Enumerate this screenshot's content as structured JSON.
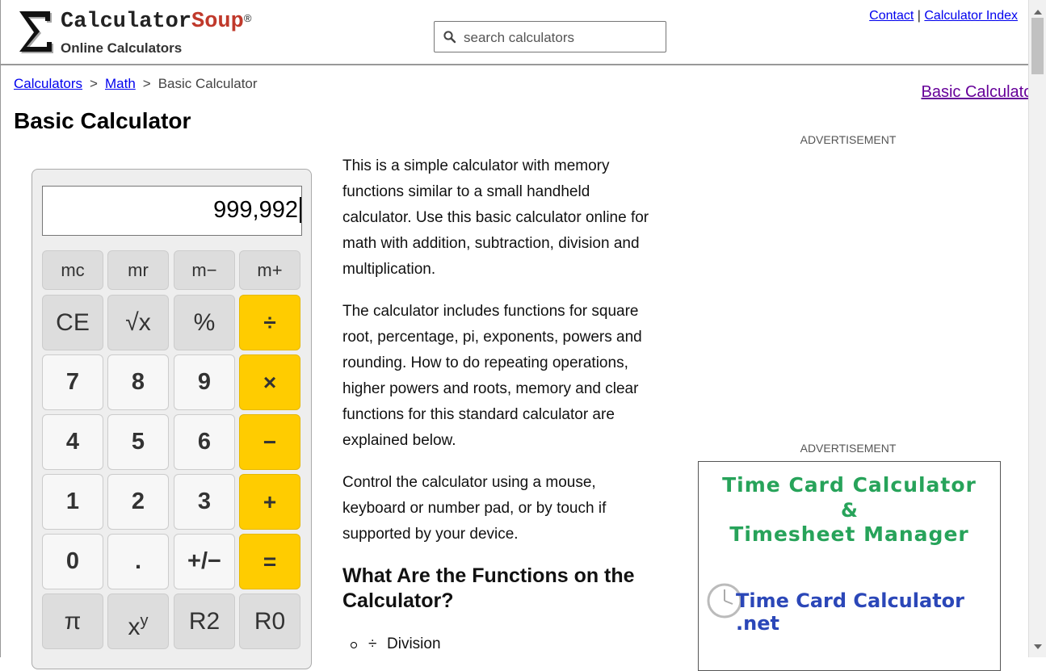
{
  "header": {
    "logo_name_a": "Calculator",
    "logo_name_b": "Soup",
    "logo_reg": "®",
    "logo_tagline": "Online Calculators",
    "search_placeholder": "search calculators",
    "links": {
      "contact": "Contact",
      "separator": "|",
      "index": "Calculator Index"
    }
  },
  "breadcrumb": {
    "items": [
      "Calculators",
      "Math"
    ],
    "current": "Basic Calculator",
    "separator": ">"
  },
  "right_link": "Basic Calculator",
  "page_title": "Basic Calculator",
  "calculator": {
    "display": "999,992",
    "memory_keys": [
      "mc",
      "mr",
      "m−",
      "m+"
    ],
    "rows": [
      [
        "CE",
        "√x",
        "%",
        "÷"
      ],
      [
        "7",
        "8",
        "9",
        "×"
      ],
      [
        "4",
        "5",
        "6",
        "−"
      ],
      [
        "1",
        "2",
        "3",
        "+"
      ],
      [
        "0",
        ".",
        "+/−",
        "="
      ]
    ],
    "bottom_keys": [
      "π",
      "x",
      "R2",
      "R0"
    ],
    "bottom_sup": "y"
  },
  "article": {
    "paragraphs": [
      "This is a simple calculator with memory functions similar to a small handheld calculator. Use this basic calculator online for math with addition, subtraction, division and multiplication.",
      "The calculator includes functions for square root, percentage, pi, exponents, powers and rounding. How to do repeating operations, higher powers and roots, memory and clear functions for this standard calculator are explained below.",
      "Control the calculator using a mouse, keyboard or number pad, or by touch if supported by your device."
    ],
    "heading": "What Are the Functions on the Calculator?",
    "list": [
      {
        "symbol": "÷",
        "label": "Division"
      }
    ]
  },
  "ads": {
    "label": "ADVERTISEMENT",
    "line1": "Time Card Calculator",
    "line2": "&",
    "line3": "Timesheet Manager",
    "brand": "Time Card Calculator .net"
  },
  "colors": {
    "operator_key": "#ffcc00",
    "function_key": "#dddddd",
    "number_key": "#f7f7f7",
    "logo_soup": "#c0392b",
    "ad_green": "#27a35a",
    "ad_blue": "#2b47b8"
  }
}
